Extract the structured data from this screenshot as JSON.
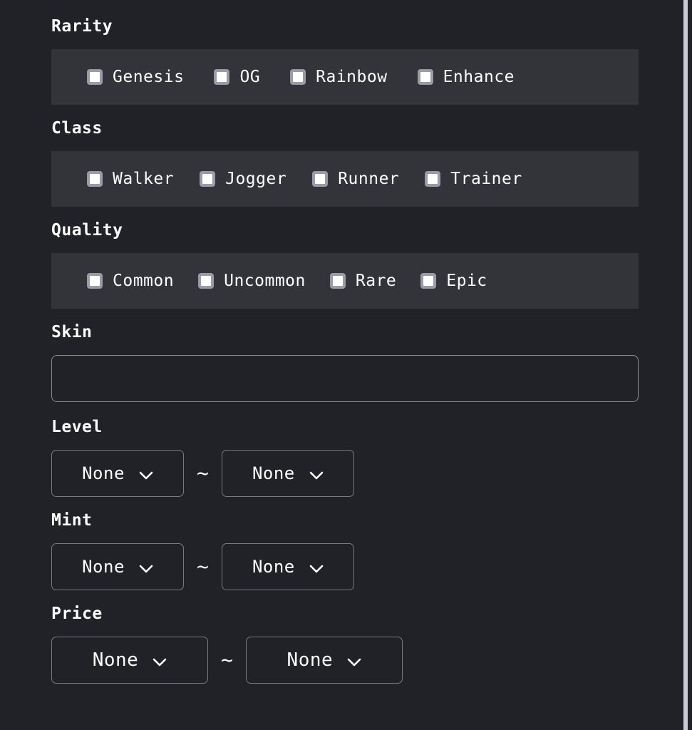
{
  "theme": {
    "page_background": "#202227",
    "group_background": "#32343a",
    "text_color": "#ffffff",
    "border_color": "#787a80",
    "checkbox_border": "#9a9aa8",
    "checkbox_fill": "#ffffff"
  },
  "filters": {
    "rarity": {
      "label": "Rarity",
      "options": [
        {
          "label": "Genesis",
          "checked": false
        },
        {
          "label": "OG",
          "checked": false
        },
        {
          "label": "Rainbow",
          "checked": false
        },
        {
          "label": "Enhance",
          "checked": false
        }
      ]
    },
    "class": {
      "label": "Class",
      "options": [
        {
          "label": "Walker",
          "checked": false
        },
        {
          "label": "Jogger",
          "checked": false
        },
        {
          "label": "Runner",
          "checked": false
        },
        {
          "label": "Trainer",
          "checked": false
        }
      ]
    },
    "quality": {
      "label": "Quality",
      "options": [
        {
          "label": "Common",
          "checked": false
        },
        {
          "label": "Uncommon",
          "checked": false
        },
        {
          "label": "Rare",
          "checked": false
        },
        {
          "label": "Epic",
          "checked": false
        }
      ]
    },
    "skin": {
      "label": "Skin",
      "value": "",
      "placeholder": ""
    },
    "level": {
      "label": "Level",
      "separator": "~",
      "min": {
        "value": "None",
        "icon": "chevron-down-icon"
      },
      "max": {
        "value": "None",
        "icon": "chevron-down-icon"
      }
    },
    "mint": {
      "label": "Mint",
      "separator": "~",
      "min": {
        "value": "None",
        "icon": "chevron-down-icon"
      },
      "max": {
        "value": "None",
        "icon": "chevron-down-icon"
      }
    },
    "price": {
      "label": "Price",
      "separator": "~",
      "min": {
        "value": "None",
        "icon": "chevron-down-icon"
      },
      "max": {
        "value": "None",
        "icon": "chevron-down-icon"
      }
    }
  }
}
